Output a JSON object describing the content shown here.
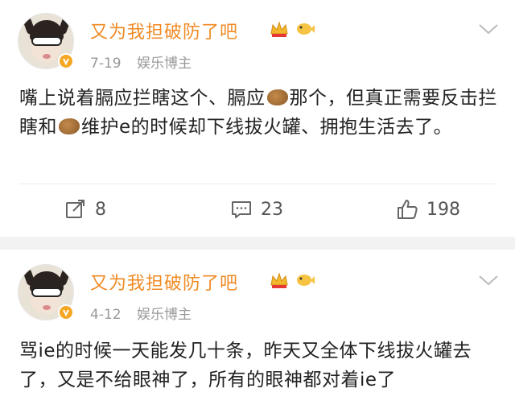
{
  "posts": [
    {
      "username": "又为我担破防了吧",
      "date": "7-19",
      "source": "娱乐博主",
      "content": {
        "part1": "嘴上说着膈应拦瞎这个、膈应",
        "part2": "那个，但真正需要反击拦瞎和",
        "part3": "维护e的时候却下线拔火罐、拥抱生活去了。"
      },
      "actions": {
        "share": "8",
        "comment": "23",
        "like": "198"
      }
    },
    {
      "username": "又为我担破防了吧",
      "date": "4-12",
      "source": "娱乐博主",
      "content": {
        "text": "骂ie的时候一天能发几十条，昨天又全体下线拔火罐去了，又是不给眼神了，所有的眼神都对着ie了"
      }
    }
  ],
  "icons": {
    "crown": "crown-icon",
    "fish": "fish-icon",
    "chevron": "chevron-down-icon",
    "share": "share-icon",
    "comment": "comment-icon",
    "like": "thumbs-up-icon",
    "potato_emoji": "potato-emoji-icon"
  },
  "colors": {
    "username": "#f08a24",
    "meta": "#999999",
    "badge": "#f5a623"
  }
}
